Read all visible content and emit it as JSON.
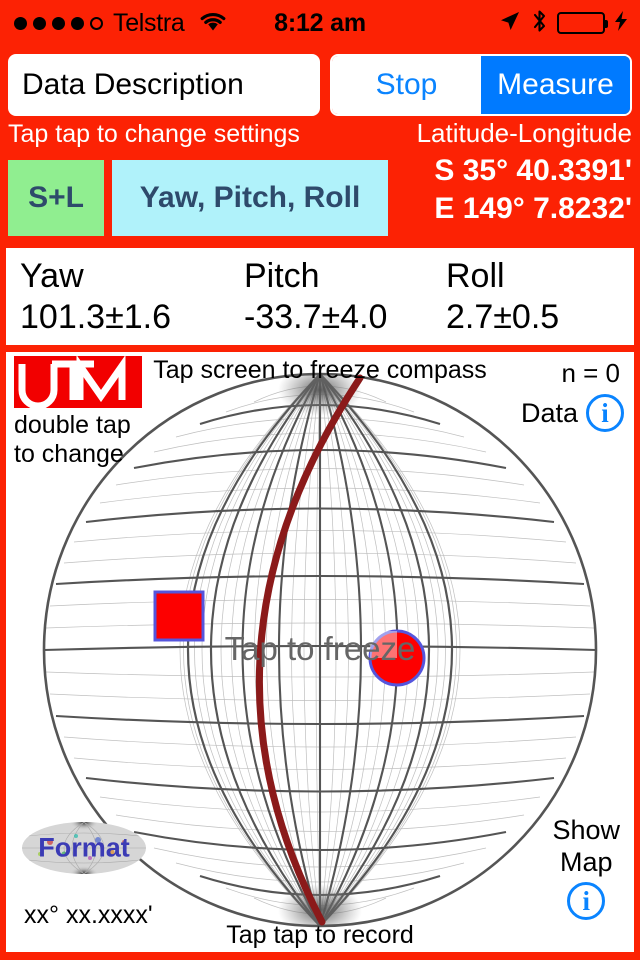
{
  "status_bar": {
    "signal_dots_filled": 4,
    "signal_dots_total": 5,
    "carrier": "Telstra",
    "wifi_icon": "wifi-icon",
    "time": "8:12 am",
    "location_icon": "location-arrow-icon",
    "bluetooth_icon": "bluetooth-icon",
    "battery_icon": "battery-charging-icon",
    "battery_color": "#4cd964"
  },
  "toolbar": {
    "description_value": "Data Description",
    "description_placeholder": "Data Description",
    "stop_label": "Stop",
    "measure_label": "Measure",
    "active_segment": "Measure",
    "accent_blue": "#007aff"
  },
  "settings": {
    "hint": "Tap tap to change settings",
    "mode_sl_label": "S+L",
    "mode_sl_color": "#90ee90",
    "mode_ypr_label": "Yaw, Pitch, Roll",
    "mode_ypr_color": "#b0f2fa",
    "label_text_color": "#2e4a6b"
  },
  "location": {
    "title": "Latitude-Longitude",
    "latitude": "S 35° 40.3391'",
    "longitude": "E 149° 7.8232'"
  },
  "orientation": {
    "yaw_label": "Yaw",
    "yaw_value": "101.3±1.6",
    "pitch_label": "Pitch",
    "pitch_value": "-33.7±4.0",
    "roll_label": "Roll",
    "roll_value": "2.7±0.5"
  },
  "compass": {
    "hint_top": "Tap screen to freeze compass",
    "hint_center": "Tap to freeze",
    "hint_bottom": "Tap tap to record",
    "count_label": "n =  0",
    "data_label": "Data",
    "data_info_icon": "info-icon",
    "show_map_line1": "Show",
    "show_map_line2": "Map",
    "show_map_info_icon": "info-icon",
    "logo_text": "UTM",
    "logo_sub_line1": "double tap",
    "logo_sub_line2": "to change",
    "format_label": "Format",
    "format_coords": "xx° xx.xxxx'",
    "great_circle_color": "#8b1a1a",
    "marker_square_color": "#fd0000",
    "marker_circle_color": "#fd0000",
    "marker_outline_color": "#5555dd",
    "net_line_color": "#555555"
  },
  "theme": {
    "background_red": "#fc2204",
    "panel_white": "#ffffff"
  }
}
